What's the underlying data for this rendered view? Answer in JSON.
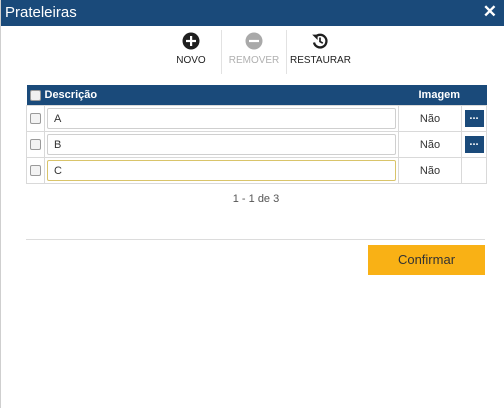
{
  "dialog": {
    "title": "Prateleiras"
  },
  "toolbar": {
    "new_label": "NOVO",
    "remove_label": "REMOVER",
    "restore_label": "RESTAURAR"
  },
  "grid": {
    "headers": {
      "description": "Descrição",
      "image": "Imagem"
    },
    "rows": [
      {
        "description": "A",
        "image": "Não",
        "has_button": true,
        "button_label": "..."
      },
      {
        "description": "B",
        "image": "Não",
        "has_button": true,
        "button_label": "..."
      },
      {
        "description": "C",
        "image": "Não",
        "has_button": false
      }
    ]
  },
  "pager": {
    "text": "1 - 1 de 3"
  },
  "footer": {
    "confirm_label": "Confirmar"
  },
  "colors": {
    "header": "#1a4a7a",
    "confirm": "#f9b115"
  }
}
